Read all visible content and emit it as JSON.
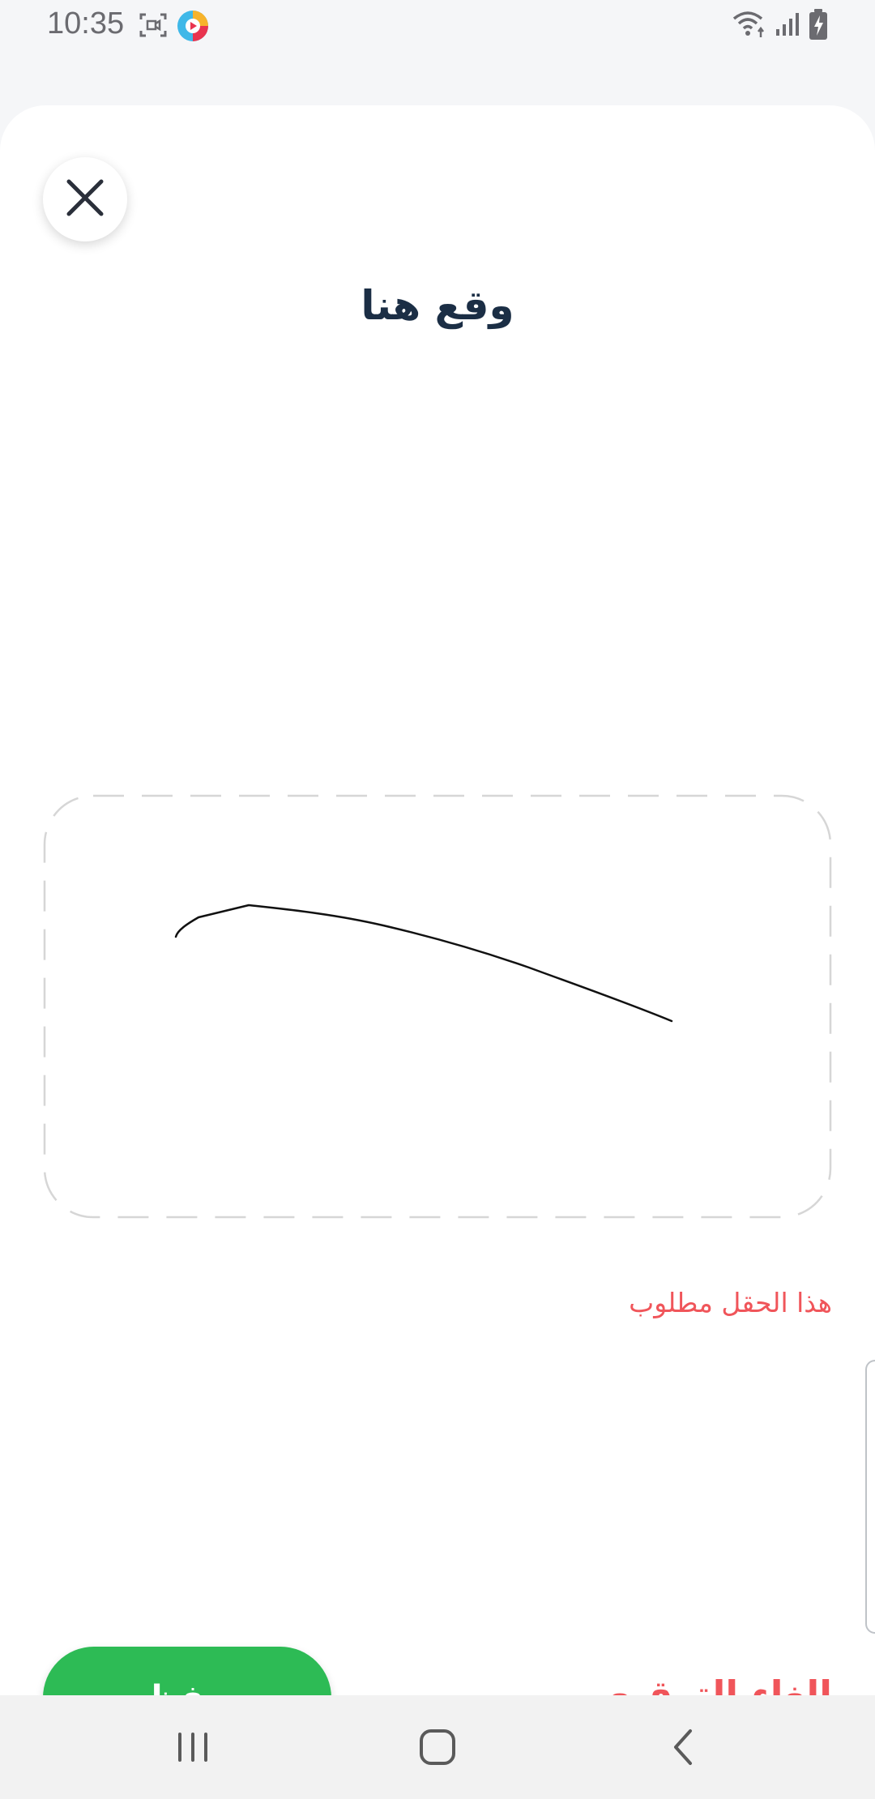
{
  "status_bar": {
    "time": "10:35",
    "icons": [
      "screen-record-icon",
      "app-notification-icon",
      "wifi-icon",
      "signal-icon",
      "battery-charging-icon"
    ]
  },
  "sheet": {
    "title": "وقع هنا",
    "error_message": "هذا الحقل مطلوب",
    "save_label": "حفظ",
    "cancel_label": "إلغاء التوقيع"
  },
  "nav_bar": {
    "buttons": [
      "recent-apps-icon",
      "home-icon",
      "back-icon"
    ]
  },
  "colors": {
    "title": "#1b2e45",
    "error": "#f0555a",
    "save_button": "#2dbb55",
    "pad_border": "#d6d6d6"
  }
}
